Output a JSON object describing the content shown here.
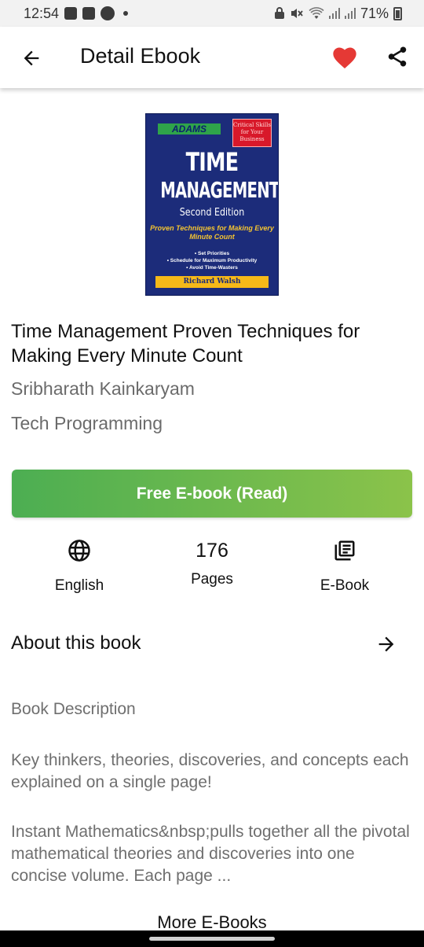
{
  "status_bar": {
    "time": "12:54",
    "battery": "71%"
  },
  "app_bar": {
    "title": "Detail Ebook",
    "icons": [
      "back-arrow-icon",
      "heart-icon",
      "share-icon"
    ],
    "heart_color": "#e53935"
  },
  "cover": {
    "publisher": "ADAMS",
    "badge": "Critical Skills for Your Business",
    "title_line1": "TIME",
    "title_line2": "MANAGEMENT",
    "edition": "Second Edition",
    "subtitle": "Proven Techniques for Making Every Minute Count",
    "bullets": [
      "• Set Priorities",
      "• Schedule for Maximum Productivity",
      "• Avoid Time-Wasters"
    ],
    "author": "Richard Walsh",
    "colors": {
      "background": "#1c2c7a",
      "accent": "#f6b918"
    }
  },
  "book": {
    "title": "Time Management Proven Techniques for Making Every Minute Count",
    "author": "Sribharath Kainkaryam",
    "category": "Tech Programming"
  },
  "read_button": {
    "label": "Free E-book (Read)",
    "gradient": [
      "#4cae52",
      "#8bc34a"
    ]
  },
  "meta": {
    "language": {
      "icon": "globe-icon",
      "label": "English"
    },
    "pages": {
      "value": "176",
      "label": "Pages"
    },
    "format": {
      "icon": "library-books-icon",
      "label": "E-Book"
    }
  },
  "about": {
    "heading": "About this book",
    "icon": "arrow-right-icon",
    "description_heading": "Book Description",
    "paragraph1": "Key thinkers, theories, discoveries, and concepts each explained on a single page!",
    "paragraph2": "Instant Mathematics&nbsp;pulls together all the pivotal mathematical theories and discoveries into one concise volume. Each page ..."
  },
  "more_section": {
    "label": "More E-Books"
  }
}
